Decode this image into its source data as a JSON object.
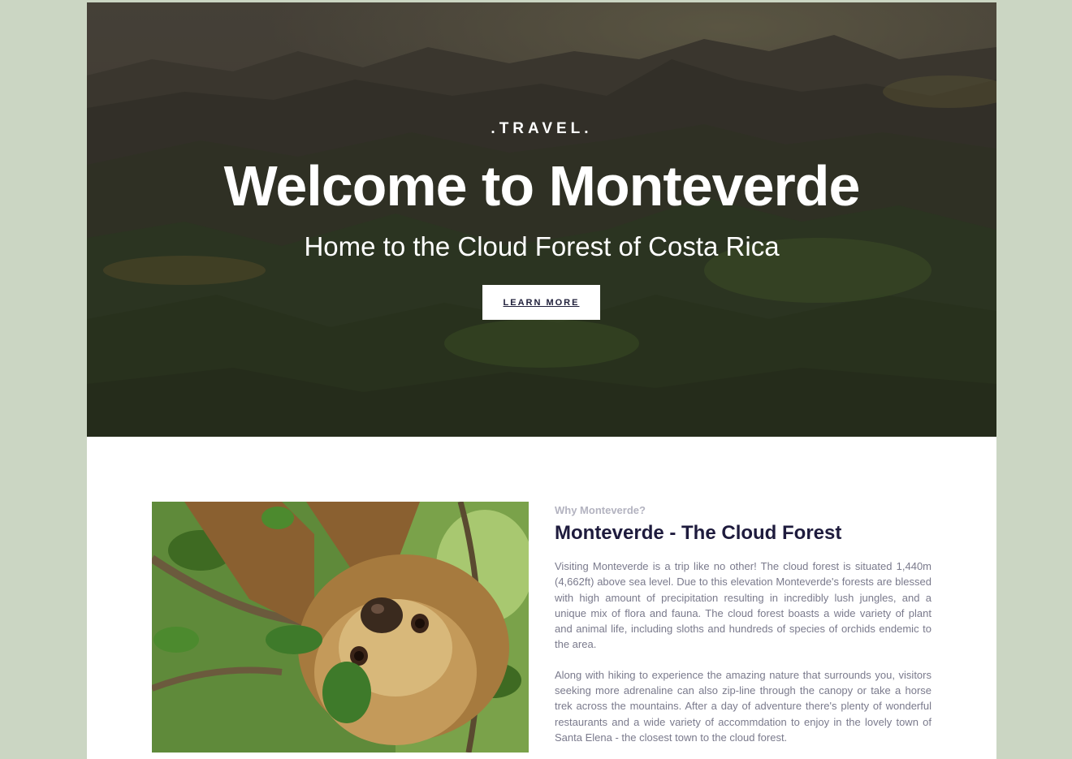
{
  "hero": {
    "eyebrow": ".TRAVEL.",
    "title": "Welcome to Monteverde",
    "subtitle": "Home to the Cloud Forest of Costa Rica",
    "button_label": "LEARN MORE"
  },
  "about": {
    "kicker": "Why Monteverde?",
    "title": "Monteverde - The Cloud Forest",
    "paragraphs": [
      "Visiting Monteverde is a trip like no other! The cloud forest is situated 1,440m (4,662ft) above sea level. Due to this elevation Monteverde's forests are blessed with high amount of precipitation resulting in incredibly lush jungles, and a unique mix of flora and fauna. The cloud forest boasts a wide variety of plant and animal life, including sloths and hundreds of species of orchids endemic to the area.",
      "Along with hiking to experience the amazing nature that surrounds you, visitors seeking more adrenaline can also zip-line through the canopy or take a horse trek across the mountains. After a day of adventure there's plenty of wonderful restaurants and a wide variety of accommdation to enjoy in the lovely town of Santa Elena - the closest town to the cloud forest."
    ]
  },
  "colors": {
    "page_bg": "#cbd6c3",
    "title_dark": "#1e1b3d",
    "kicker_gray": "#b3b3c0",
    "body_gray": "#7a7a8c"
  },
  "images": {
    "hero": "mountain-landscape-photo",
    "about": "sloth-photo"
  }
}
